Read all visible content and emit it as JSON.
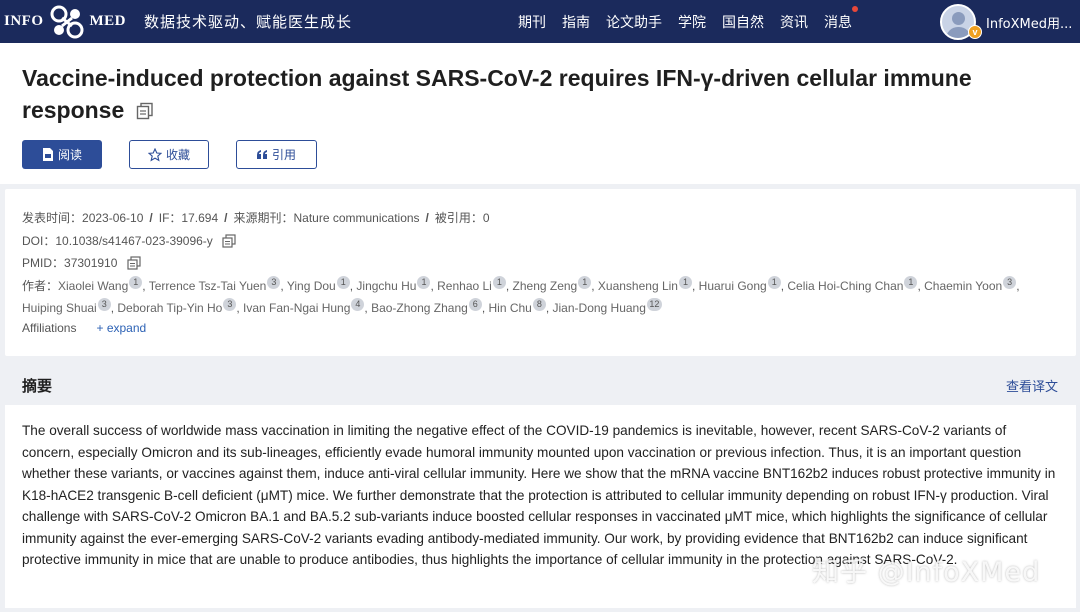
{
  "brand": {
    "left": "INFO",
    "right": "MED",
    "slogan": "数据技术驱动、赋能医生成长"
  },
  "nav": [
    "期刊",
    "指南",
    "论文助手",
    "学院",
    "国自然",
    "资讯",
    "消息"
  ],
  "user": {
    "name": "InfoXMed用...",
    "badge": "v"
  },
  "article": {
    "title": "Vaccine-induced protection against SARS-CoV-2 requires IFN-γ-driven cellular immune response",
    "buttons": {
      "read": "阅读",
      "favorite": "收藏",
      "cite": "引用"
    }
  },
  "meta": {
    "pub_date_label": "发表时间：",
    "pub_date": "2023-06-10",
    "if_label": "IF：",
    "if_value": "17.694",
    "journal_label": "来源期刊：",
    "journal": "Nature communications",
    "cited_label": "被引用：",
    "cited": "0",
    "doi_label": "DOI：",
    "doi": "10.1038/s41467-023-39096-y",
    "pmid_label": "PMID：",
    "pmid": "37301910",
    "authors_label": "作者：",
    "authors": [
      {
        "name": "Xiaolei Wang",
        "aff": "1"
      },
      {
        "name": "Terrence Tsz-Tai Yuen",
        "aff": "3"
      },
      {
        "name": "Ying Dou",
        "aff": "1"
      },
      {
        "name": "Jingchu Hu",
        "aff": "1"
      },
      {
        "name": "Renhao Li",
        "aff": "1"
      },
      {
        "name": "Zheng Zeng",
        "aff": "1"
      },
      {
        "name": "Xuansheng Lin",
        "aff": "1"
      },
      {
        "name": "Huarui Gong",
        "aff": "1"
      },
      {
        "name": "Celia Hoi-Ching Chan",
        "aff": "1"
      },
      {
        "name": "Chaemin Yoon",
        "aff": "3"
      },
      {
        "name": "Huiping Shuai",
        "aff": "3"
      },
      {
        "name": "Deborah Tip-Yin Ho",
        "aff": "3"
      },
      {
        "name": "Ivan Fan-Ngai Hung",
        "aff": "4"
      },
      {
        "name": "Bao-Zhong Zhang",
        "aff": "6"
      },
      {
        "name": "Hin Chu",
        "aff": "8"
      },
      {
        "name": "Jian-Dong Huang",
        "aff": "12"
      }
    ],
    "affiliations": "Affiliations",
    "expand": "+ expand"
  },
  "abstract": {
    "heading": "摘要",
    "translate": "查看译文",
    "text": "The overall success of worldwide mass vaccination in limiting the negative effect of the COVID-19 pandemics is inevitable, however, recent SARS-CoV-2 variants of concern, especially Omicron and its sub-lineages, efficiently evade humoral immunity mounted upon vaccination or previous infection. Thus, it is an important question whether these variants, or vaccines against them, induce anti-viral cellular immunity. Here we show that the mRNA vaccine BNT162b2 induces robust protective immunity in K18-hACE2 transgenic B-cell deficient (μMT) mice. We further demonstrate that the protection is attributed to cellular immunity depending on robust IFN-γ production. Viral challenge with SARS-CoV-2 Omicron BA.1 and BA.5.2 sub-variants induce boosted cellular responses in vaccinated μMT mice, which highlights the significance of cellular immunity against the ever-emerging SARS-CoV-2 variants evading antibody-mediated immunity. Our work, by providing evidence that BNT162b2 can induce significant protective immunity in mice that are unable to produce antibodies, thus highlights the importance of cellular immunity in the protection against SARS-CoV-2."
  },
  "watermark": "知乎 @InfoXMed"
}
